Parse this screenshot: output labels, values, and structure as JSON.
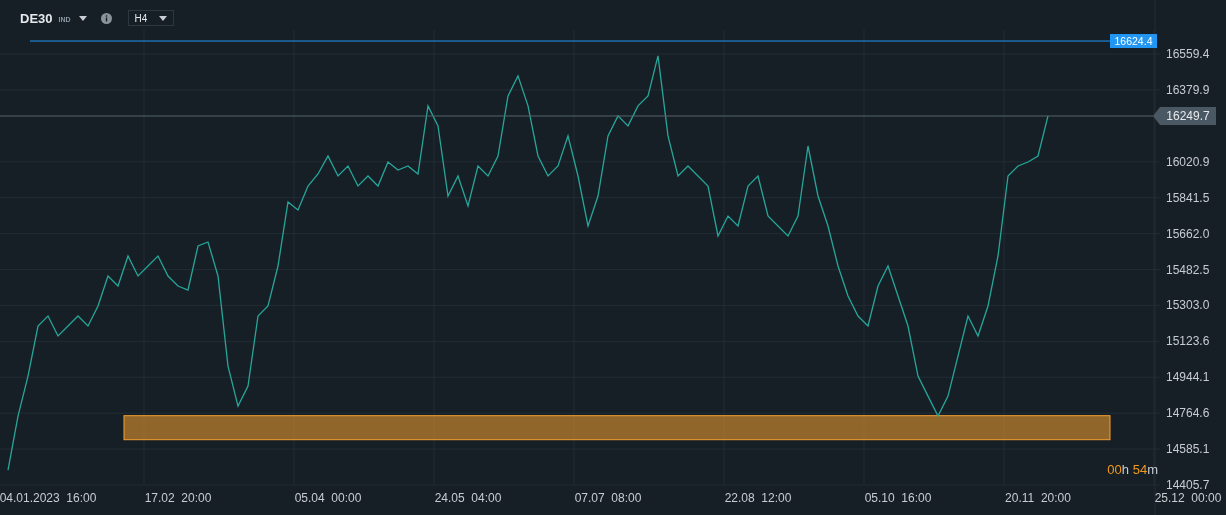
{
  "header": {
    "symbol": "DE30",
    "badge": "IND",
    "timeframe": "H4"
  },
  "chart": {
    "chart_data": {
      "type": "line",
      "grid": true,
      "ylim": [
        14255.7,
        16829.4
      ],
      "categories": [
        null,
        null,
        null,
        null,
        "04.01.2023  16:00",
        null,
        null,
        null,
        null,
        null,
        null,
        null,
        null,
        null,
        null,
        null,
        null,
        "17.02  20:00",
        null,
        null,
        null,
        null,
        null,
        null,
        null,
        null,
        null,
        null,
        null,
        null,
        null,
        null,
        "05.04  00:00",
        null,
        null,
        null,
        null,
        null,
        null,
        null,
        null,
        null,
        null,
        null,
        null,
        null,
        "24.05  04:00",
        null,
        null,
        null,
        null,
        null,
        null,
        null,
        null,
        null,
        null,
        null,
        null,
        null,
        "07.07  08:00",
        null,
        null,
        null,
        null,
        null,
        null,
        null,
        null,
        null,
        null,
        null,
        null,
        null,
        null,
        "22.08  12:00",
        null,
        null,
        null,
        null,
        null,
        null,
        null,
        null,
        null,
        null,
        null,
        null,
        null,
        "05.10  16:00",
        null,
        null,
        null,
        null,
        null,
        null,
        null,
        null,
        null,
        null,
        null,
        null,
        null,
        "20.11  20:00",
        null,
        null,
        null,
        null,
        null,
        null,
        null,
        null,
        null,
        null,
        null,
        null,
        null,
        null,
        "25.12  00:00"
      ],
      "yticks": [
        16559.4,
        16379.9,
        16020.9,
        15841.5,
        {
          "value": 15662,
          "label": "15662.0"
        },
        15482.5,
        {
          "value": 15303,
          "label": "15303.0"
        },
        15123.6,
        14944.1,
        14764.6,
        14585.1,
        14405.7
      ],
      "series": [
        {
          "color": "#26a69a",
          "values": [
            14480,
            14750,
            14950,
            15200,
            15250,
            15150,
            15200,
            15250,
            15200,
            15300,
            15450,
            15400,
            15550,
            15450,
            15500,
            15550,
            15450,
            15400,
            15380,
            15600,
            15620,
            15450,
            15000,
            14800,
            14900,
            15250,
            15300,
            15500,
            15820,
            15780,
            15900,
            15960,
            16050,
            15950,
            16000,
            15900,
            15950,
            15900,
            16020,
            15980,
            16000,
            15960,
            16300,
            16200,
            15850,
            15950,
            15800,
            16000,
            15950,
            16050,
            16350,
            16450,
            16300,
            16050,
            15950,
            16000,
            16150,
            15950,
            15700,
            15850,
            16150,
            16250,
            16200,
            16300,
            16350,
            16550,
            16150,
            15950,
            16000,
            15950,
            15900,
            15650,
            15750,
            15700,
            15900,
            15950,
            15750,
            15700,
            15650,
            15750,
            16100,
            15850,
            15700,
            15500,
            15350,
            15250,
            15200,
            15400,
            15500,
            15350,
            15200,
            14950,
            14850,
            14750,
            14850,
            15050,
            15250,
            15150,
            15300,
            15550,
            15950,
            16000,
            16020,
            16050,
            16250,
            null,
            null,
            null,
            null,
            null,
            null,
            null,
            null,
            null,
            null,
            null,
            null,
            null,
            null
          ]
        }
      ],
      "ref_lines": [
        {
          "axis": "y",
          "value": 16624.4,
          "label": "16624.4",
          "color": "#2196f3"
        },
        {
          "axis": "y",
          "value": 16249.7,
          "label": "16249.7",
          "color": "#4a5863"
        }
      ],
      "bands": [
        {
          "axis": "y",
          "from": 14632,
          "to": 14752,
          "color": "#f5a030"
        }
      ]
    }
  },
  "countdown": {
    "hours": "00",
    "hours_unit": "h",
    "minutes": "54",
    "minutes_unit": "m"
  }
}
